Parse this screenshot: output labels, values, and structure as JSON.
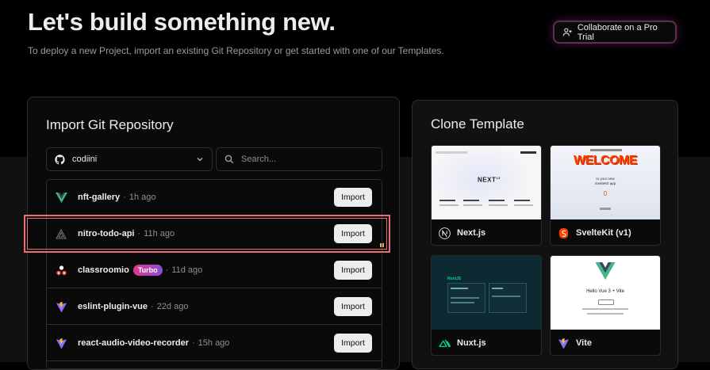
{
  "header": {
    "title": "Let's build something new.",
    "subtitle": "To deploy a new Project, import an existing Git Repository or get started with one of our Templates.",
    "pro_button_label": "Collaborate on a Pro Trial"
  },
  "import_panel": {
    "title": "Import Git Repository",
    "account": "codiini",
    "search_placeholder": "Search...",
    "repos": [
      {
        "name": "nft-gallery",
        "sep": "·",
        "time": "1h ago",
        "icon": "vue-icon",
        "badge": "",
        "import_label": "Import"
      },
      {
        "name": "nitro-todo-api",
        "sep": "·",
        "time": "11h ago",
        "icon": "triangle-icon",
        "badge": "",
        "import_label": "Import"
      },
      {
        "name": "classroomio",
        "sep": "·",
        "time": "11d ago",
        "icon": "classroomio-icon",
        "badge": "Turbo",
        "import_label": "Import"
      },
      {
        "name": "eslint-plugin-vue",
        "sep": "·",
        "time": "22d ago",
        "icon": "vite-icon",
        "badge": "",
        "import_label": "Import"
      },
      {
        "name": "react-audio-video-recorder",
        "sep": "·",
        "time": "15h ago",
        "icon": "vite-icon",
        "badge": "",
        "import_label": "Import"
      }
    ]
  },
  "clone_panel": {
    "title": "Clone Template",
    "templates": [
      {
        "name": "Next.js",
        "icon": "nextjs-icon"
      },
      {
        "name": "SvelteKit (v1)",
        "icon": "svelte-icon"
      },
      {
        "name": "Nuxt.js",
        "icon": "nuxt-icon"
      },
      {
        "name": "Vite",
        "icon": "vite-icon"
      }
    ],
    "thumbs": {
      "next_wordmark": "NEXT",
      "next_version": "13",
      "svelte_welcome": "WELCOME",
      "svelte_line1": "to your new",
      "svelte_line2": "SvelteKit app",
      "svelte_count": "0",
      "nuxt_brand": "NuxtJS",
      "vite_heading": "Hello Vue 3 + Vite"
    }
  },
  "colors": {
    "background": "#000000",
    "panel": "#0a0a0a",
    "border": "#2e2e2e",
    "highlight": "#e56f72",
    "vue_green": "#41b883",
    "svelte_orange": "#ff3e00",
    "nuxt_green": "#00dc82",
    "vite_purple": "#bd34fe"
  }
}
